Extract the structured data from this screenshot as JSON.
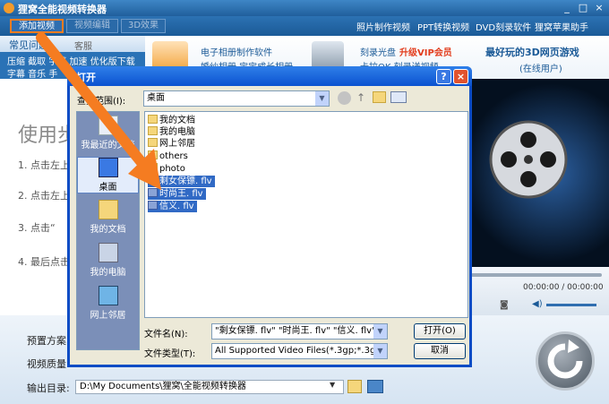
{
  "app": {
    "title": "狸窝全能视频转换器",
    "win_controls": [
      "_",
      "□",
      "×"
    ]
  },
  "toolbar": {
    "add_video": "添加视频",
    "edit_video": "视频编辑",
    "effect_3d": "3D效果",
    "links": [
      "照片制作视频",
      "PPT转换视频",
      "DVD刻录软件",
      "狸窝苹果助手"
    ]
  },
  "faq": {
    "title": "常见问题",
    "qq": "客服QQ876292449",
    "row1": "压缩  截取  字幕  加速  优化版下载",
    "row2": "字幕  音乐  手"
  },
  "promo": {
    "a1": "电子相册制作软件",
    "a2": "婚纱相册  宝宝成长相册",
    "b1": "刻录光盘",
    "b_vip": "升级VIP会员",
    "b2": "卡拉OK 刻录送视频",
    "c1": "最好玩的3D网页游戏",
    "c2": "(在线用户)"
  },
  "guide": {
    "heading": "使用步",
    "steps": [
      "1. 点击左上",
      "2. 点击左上",
      "3. 点击“",
      "4. 最后点击"
    ]
  },
  "player": {
    "time": "00:00:00 / 00:00:00"
  },
  "bottom": {
    "preset_label": "预置方案:",
    "quality_label": "视频质量:",
    "output_label": "输出目录:",
    "output_path": "D:\\My Documents\\狸窝\\全能视频转换器"
  },
  "dialog": {
    "title": "打开",
    "help": "?",
    "close": "×",
    "lookin_label": "查找范围(I):",
    "lookin_value": "桌面",
    "places": [
      "我最近的文档",
      "桌面",
      "我的文档",
      "我的电脑",
      "网上邻居"
    ],
    "files": [
      {
        "name": "我的文档",
        "type": "folder",
        "selected": false
      },
      {
        "name": "我的电脑",
        "type": "folder",
        "selected": false
      },
      {
        "name": "网上邻居",
        "type": "folder",
        "selected": false
      },
      {
        "name": "others",
        "type": "folder",
        "selected": false
      },
      {
        "name": "photo",
        "type": "folder",
        "selected": false
      },
      {
        "name": "剩女保镖. flv",
        "type": "flv",
        "selected": true
      },
      {
        "name": "时尚王. flv",
        "type": "flv",
        "selected": true
      },
      {
        "name": "信义. flv",
        "type": "flv",
        "selected": true
      }
    ],
    "filename_label": "文件名(N):",
    "filename_value": "\"剩女保镖. flv\"  \"时尚王. flv\"  \"信义. flv\"",
    "filetype_label": "文件类型(T):",
    "filetype_value": "All Supported Video Files(*.3gp;*.3gp",
    "open": "打开(O)",
    "cancel": "取消"
  },
  "colors": {
    "accent": "#f57c21",
    "selection": "#316ac5",
    "xp_blue": "#0b52d0"
  }
}
